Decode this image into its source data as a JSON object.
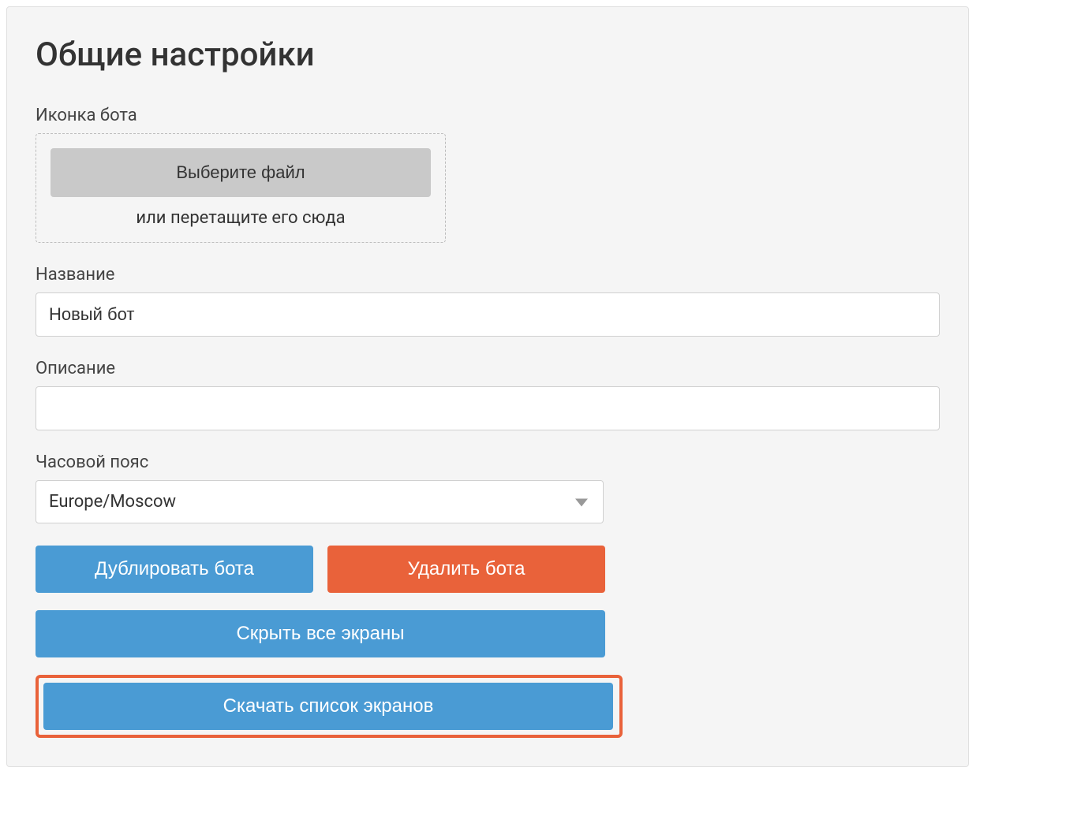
{
  "title": "Общие настройки",
  "icon_section": {
    "label": "Иконка бота",
    "button": "Выберите файл",
    "hint": "или перетащите его сюда"
  },
  "name_section": {
    "label": "Название",
    "value": "Новый бот"
  },
  "description_section": {
    "label": "Описание",
    "value": ""
  },
  "timezone_section": {
    "label": "Часовой пояс",
    "value": "Europe/Moscow"
  },
  "buttons": {
    "duplicate": "Дублировать бота",
    "delete": "Удалить бота",
    "hide_all": "Скрыть все экраны",
    "download_list": "Скачать список экранов"
  }
}
